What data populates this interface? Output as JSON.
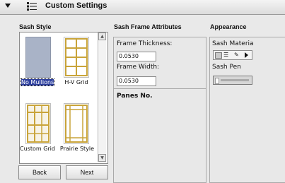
{
  "header": {
    "title": "Custom Settings",
    "collapse_icon": "triangle-down-icon",
    "settings_icon": "settings-list-icon"
  },
  "sash_style": {
    "title": "Sash Style",
    "items": [
      {
        "label": "No Mullions",
        "selected": true
      },
      {
        "label": "H-V Grid",
        "selected": false
      },
      {
        "label": "Custom Grid",
        "selected": false
      },
      {
        "label": "Prairie Style",
        "selected": false
      }
    ],
    "back_label": "Back",
    "next_label": "Next"
  },
  "sash_frame": {
    "title": "Sash Frame Attributes",
    "thickness_label": "Frame Thickness:",
    "thickness_value": "0.0530",
    "width_label": "Frame Width:",
    "width_value": "0.0530",
    "panes_label": "Panes No."
  },
  "appearance": {
    "title": "Appearance",
    "material_label": "Sash Materia",
    "pen_label": "Sash Pen"
  },
  "colors": {
    "accent": "#2d3f9e",
    "gold": "#c9a43a",
    "glass": "#a8b2c6"
  }
}
